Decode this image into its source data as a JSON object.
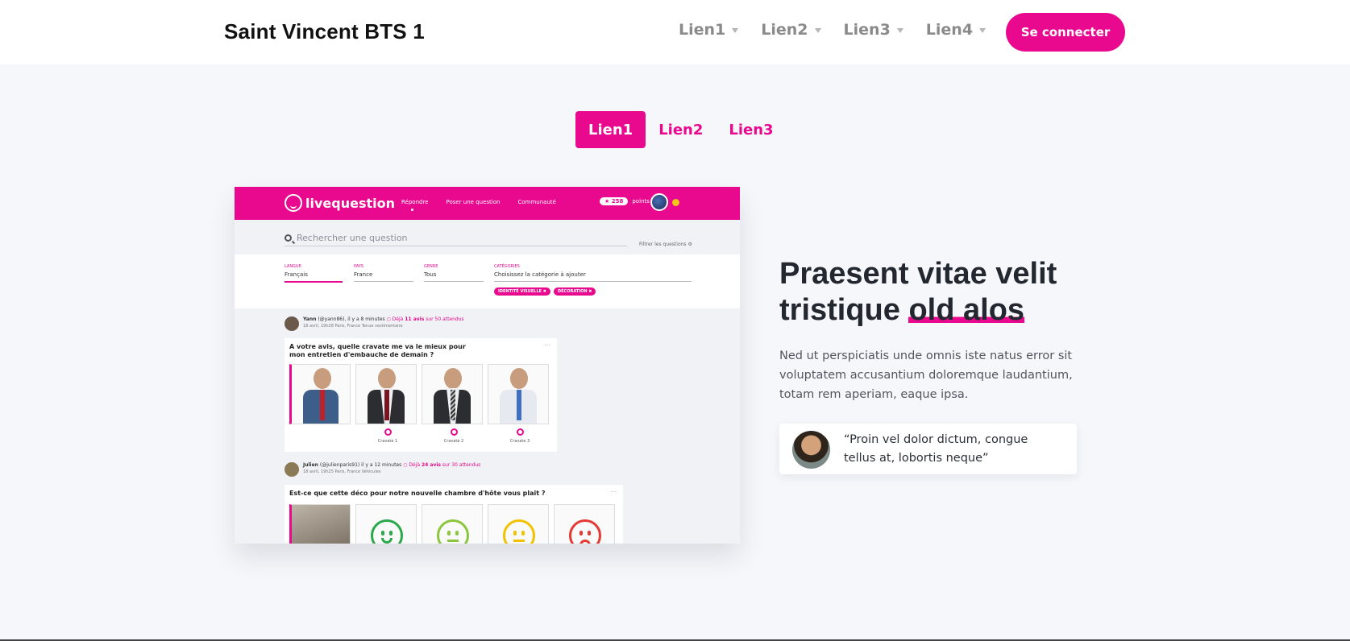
{
  "header": {
    "brand": "Saint Vincent BTS 1",
    "nav": [
      "Lien1",
      "Lien2",
      "Lien3",
      "Lien4"
    ],
    "cta": "Se connecter"
  },
  "tabs": {
    "items": [
      "Lien1",
      "Lien2",
      "Lien3"
    ],
    "active": "Lien1"
  },
  "mockup": {
    "app_name": "livequestion",
    "nav": [
      "Répondre",
      "Poser une question",
      "Communauté"
    ],
    "points_value": "258",
    "points_label": "points",
    "search_placeholder": "Rechercher une question",
    "filter_label": "Filtrer les questions",
    "filters": [
      {
        "label": "LANGUE",
        "value": "Français"
      },
      {
        "label": "PAYS",
        "value": "France"
      },
      {
        "label": "GENRE",
        "value": "Tous"
      },
      {
        "label": "CATÉGORIES",
        "value": "Choisissez la catégorie à ajouter"
      }
    ],
    "chips": [
      "IDENTITÉ VISUELLE ✖",
      "DÉCORATION ✖"
    ],
    "post1": {
      "author": "Yann",
      "meta": "(@yann86), il y a 8 minutes",
      "votes_prefix": "Déjà",
      "votes_count": "11 avis",
      "votes_suffix": "sur 50 attendus",
      "sub": "18 avril, 19h28   Paris, France   Tenue vestimentaire",
      "question": "A votre avis, quelle cravate me va le mieux pour mon entretien d'embauche de demain ?",
      "options": [
        "Cravate 1",
        "Cravate 2",
        "Cravate 3"
      ]
    },
    "post2": {
      "author": "Julien",
      "meta": "(@julienparis91) il y a 12 minutes",
      "votes_prefix": "Déjà",
      "votes_count": "24 avis",
      "votes_suffix": "sur 30 attendus",
      "sub": "18 avril, 19h25   Paris, France   Véhicules",
      "question": "Est-ce que cette déco pour notre nouvelle chambre d'hôte vous plait ?"
    }
  },
  "hero": {
    "headline_start": "Praesent vitae velit tristique ",
    "headline_highlight": "old alos",
    "paragraph": "Ned ut perspiciatis unde omnis iste natus error sit voluptatem accusantium doloremque laudantium, totam rem aperiam, eaque ipsa.",
    "quote": "“Proin vel dolor dictum, congue tellus at, lobortis neque”"
  },
  "colors": {
    "accent": "#e8098e",
    "background": "#f6f7fb"
  }
}
